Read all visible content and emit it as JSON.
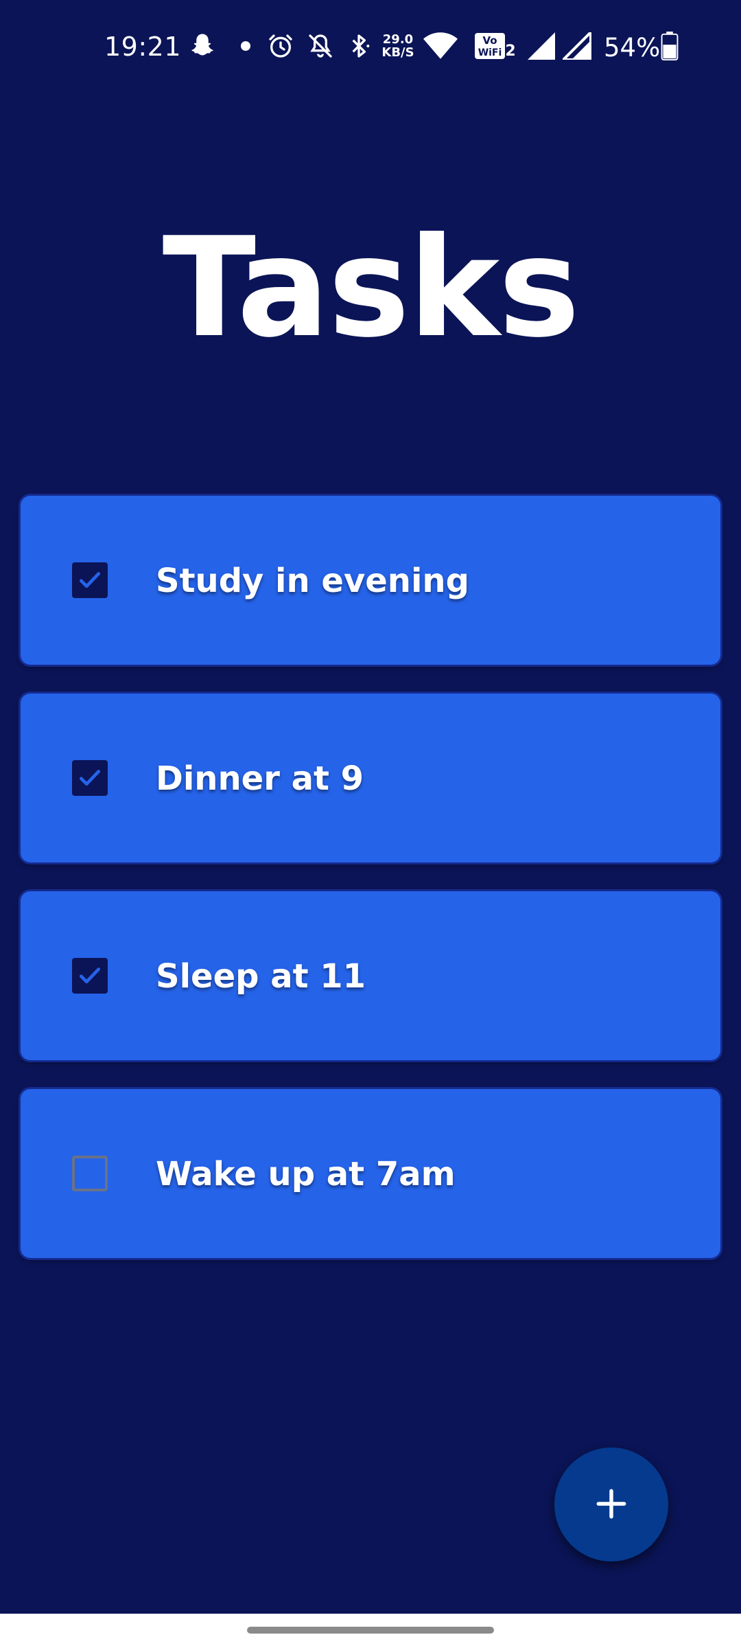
{
  "status_bar": {
    "time": "19:21",
    "net_speed_value": "29.0",
    "net_speed_unit": "KB/S",
    "battery_percent": "54%",
    "icons": [
      "snapchat-icon",
      "notification-dot-icon",
      "alarm-icon",
      "mute-icon",
      "bluetooth-icon",
      "wifi-icon",
      "vowifi-icon",
      "signal-icon",
      "signal-icon",
      "battery-icon"
    ]
  },
  "page": {
    "title": "Tasks"
  },
  "tasks": [
    {
      "label": "Study in evening",
      "checked": true
    },
    {
      "label": "Dinner at 9",
      "checked": true
    },
    {
      "label": "Sleep at 11",
      "checked": true
    },
    {
      "label": "Wake up at 7am",
      "checked": false
    }
  ],
  "fab": {
    "icon": "plus-icon",
    "label": "+"
  },
  "colors": {
    "background": "#0b1456",
    "card": "#2563e9",
    "fab": "#053a8e",
    "checkmark": "#2563e9"
  }
}
